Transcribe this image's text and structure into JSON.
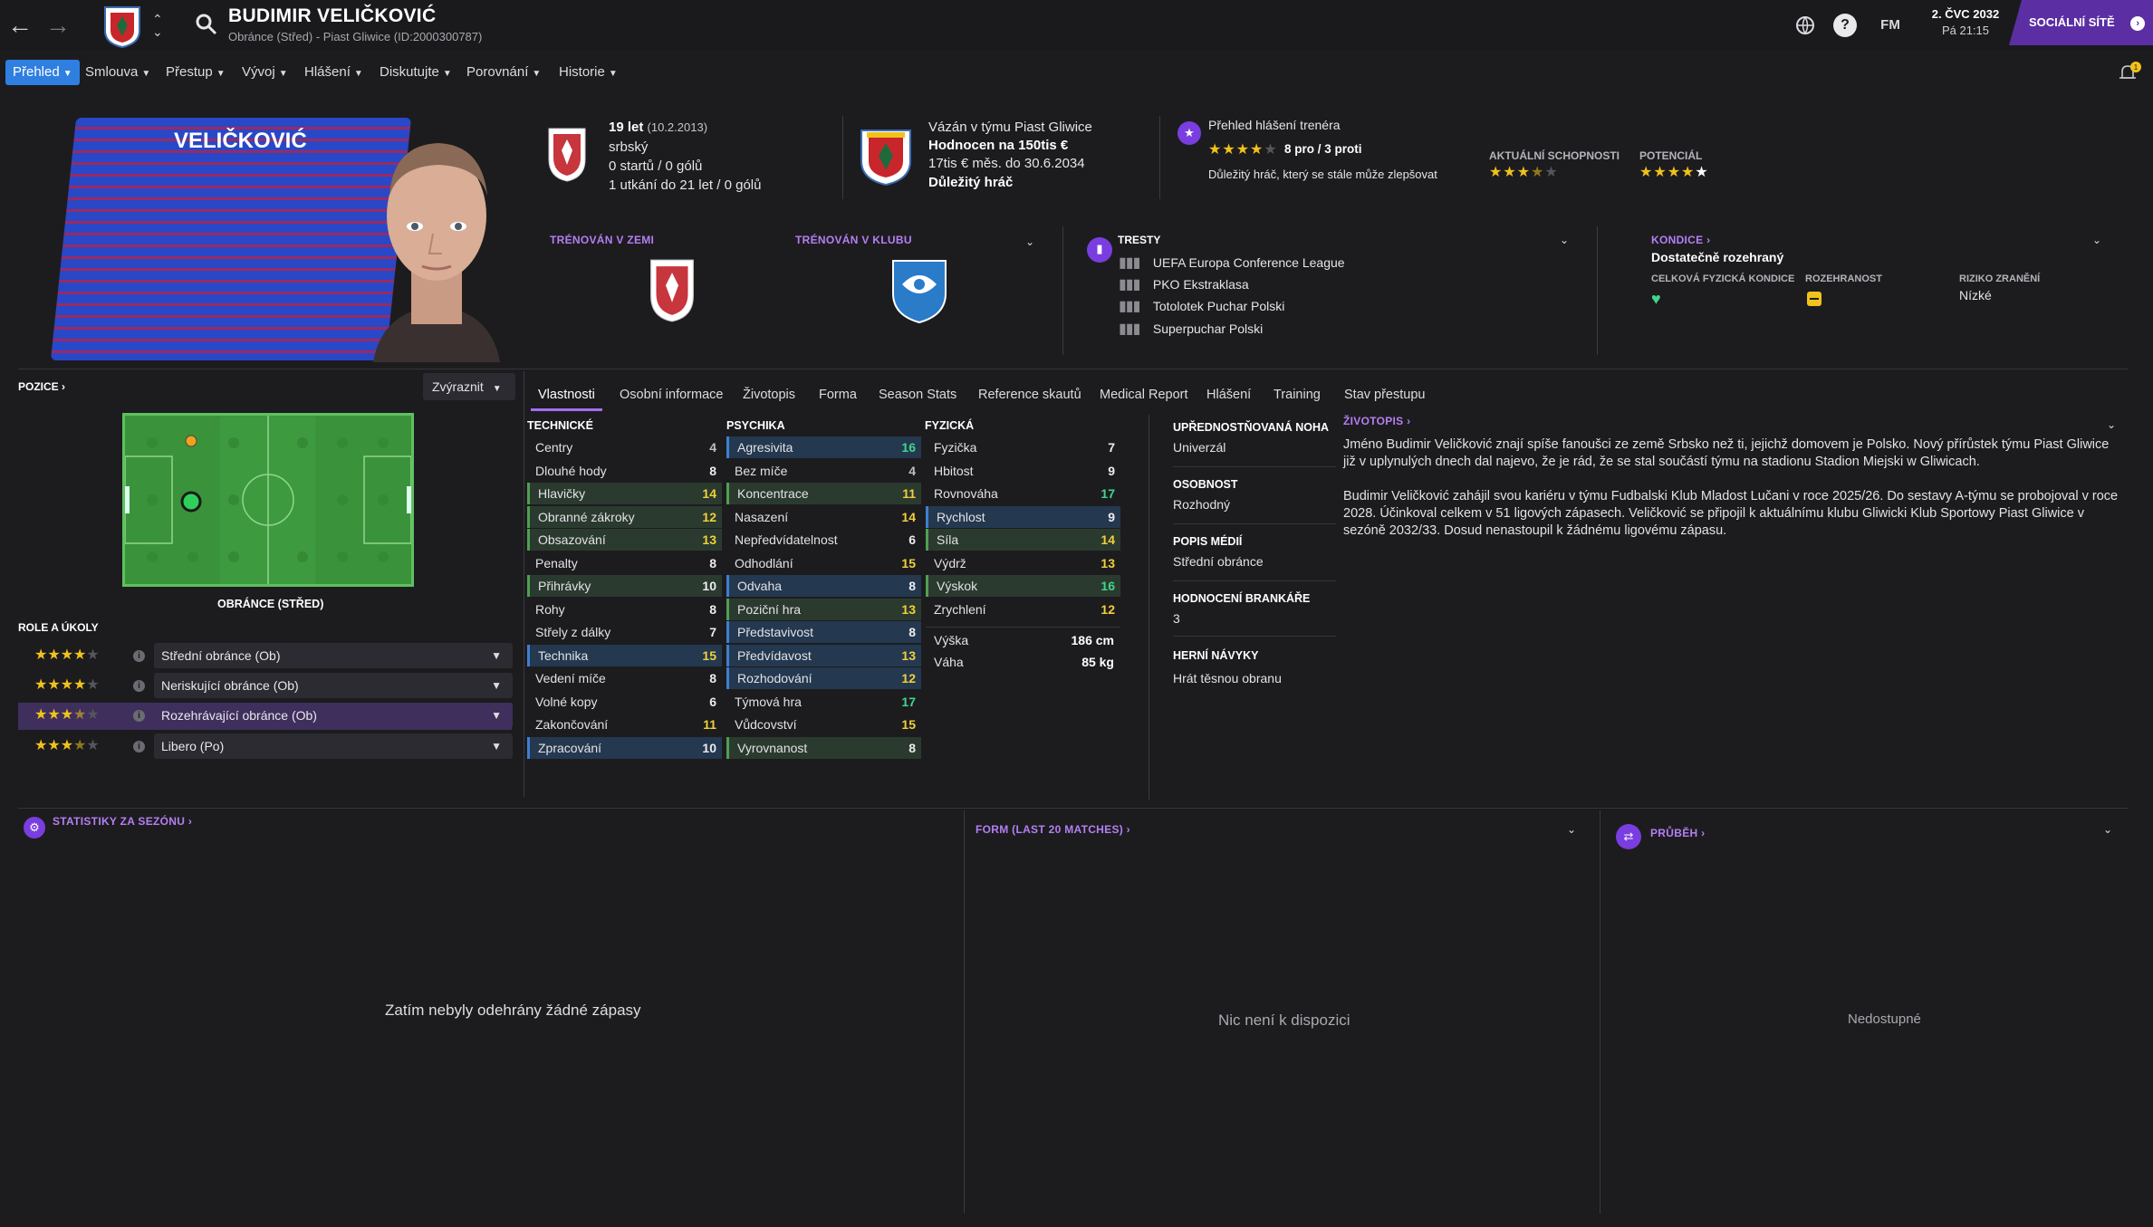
{
  "player": {
    "name": "BUDIMIR VELIČKOVIĆ",
    "subtitle": "Obránce (Střed) - Piast Gliwice (ID:2000300787)",
    "kit_name": "VELIČKOVIĆ"
  },
  "topbar": {
    "date": "2. ČVC 2032",
    "time": "Pá 21:15",
    "fm_label": "FM",
    "social_label": "SOCIÁLNÍ SÍTĚ",
    "help_label": "?",
    "notif_count": "1"
  },
  "menu": [
    {
      "label": "Přehled"
    },
    {
      "label": "Smlouva"
    },
    {
      "label": "Přestup"
    },
    {
      "label": "Vývoj"
    },
    {
      "label": "Hlášení"
    },
    {
      "label": "Diskutujte"
    },
    {
      "label": "Porovnání"
    },
    {
      "label": "Historie"
    }
  ],
  "bio_card": {
    "age": "19 let",
    "dob": "(10.2.2013)",
    "nationality": "srbský",
    "apps": "0 startů / 0 gólů",
    "u21": "1 utkání do 21 let / 0 gólů"
  },
  "contract": {
    "line1": "Vázán v týmu Piast Gliwice",
    "value": "Hodnocen na 150tis €",
    "wage": "17tis € měs. do 30.6.2034",
    "status": "Důležitý hráč"
  },
  "coach_report": {
    "title": "Přehled hlášení trenéra",
    "pros_cons": "8 pro / 3 proti",
    "note": "Důležitý hráč, který se stále může zlepšovat",
    "current_label": "AKTUÁLNÍ SCHOPNOSTI",
    "potential_label": "POTENCIÁL",
    "report_stars": 4,
    "current_stars": 3.5,
    "potential_stars": 5
  },
  "trained": {
    "nation_label": "TRÉNOVÁN V ZEMI",
    "club_label": "TRÉNOVÁN V KLUBU"
  },
  "bans": {
    "title": "TRESTY",
    "items": [
      "UEFA Europa Conference League",
      "PKO Ekstraklasa",
      "Totolotek Puchar Polski",
      "Superpuchar Polski"
    ]
  },
  "condition": {
    "title": "KONDICE",
    "status": "Dostatečně rozehraný",
    "fitness_label": "CELKOVÁ FYZICKÁ KONDICE",
    "sharpness_label": "ROZEHRANOST",
    "injury_label": "RIZIKO ZRANĚNÍ",
    "injury_value": "Nízké"
  },
  "position": {
    "title": "POZICE",
    "highlight_btn": "Zvýraznit",
    "caption": "OBRÁNCE (STŘED)",
    "roles_title": "ROLE A ÚKOLY",
    "roles": [
      {
        "label": "Střední obránce (Ob)",
        "stars": 4
      },
      {
        "label": "Neriskující obránce (Ob)",
        "stars": 4
      },
      {
        "label": "Rozehrávající obránce (Ob)",
        "stars": 3.5
      },
      {
        "label": "Libero (Po)",
        "stars": 3.5
      }
    ]
  },
  "tabs": [
    "Vlastnosti",
    "Osobní informace",
    "Životopis",
    "Forma",
    "Season Stats",
    "Reference skautů",
    "Medical Report",
    "Hlášení",
    "Training",
    "Stav přestupu"
  ],
  "attributes": {
    "technical_title": "TECHNICKÉ",
    "mental_title": "PSYCHIKA",
    "physical_title": "FYZICKÁ",
    "technical": [
      {
        "name": "Centry",
        "value": "4"
      },
      {
        "name": "Dlouhé hody",
        "value": "8"
      },
      {
        "name": "Hlavičky",
        "value": "14"
      },
      {
        "name": "Obranné zákroky",
        "value": "12"
      },
      {
        "name": "Obsazování",
        "value": "13"
      },
      {
        "name": "Penalty",
        "value": "8"
      },
      {
        "name": "Přihrávky",
        "value": "10"
      },
      {
        "name": "Rohy",
        "value": "8"
      },
      {
        "name": "Střely z dálky",
        "value": "7"
      },
      {
        "name": "Technika",
        "value": "15"
      },
      {
        "name": "Vedení míče",
        "value": "8"
      },
      {
        "name": "Volné kopy",
        "value": "6"
      },
      {
        "name": "Zakončování",
        "value": "11"
      },
      {
        "name": "Zpracování",
        "value": "10"
      }
    ],
    "mental": [
      {
        "name": "Agresivita",
        "value": "16"
      },
      {
        "name": "Bez míče",
        "value": "4"
      },
      {
        "name": "Koncentrace",
        "value": "11"
      },
      {
        "name": "Nasazení",
        "value": "14"
      },
      {
        "name": "Nepředvídatelnost",
        "value": "6"
      },
      {
        "name": "Odhodlání",
        "value": "15"
      },
      {
        "name": "Odvaha",
        "value": "8"
      },
      {
        "name": "Poziční hra",
        "value": "13"
      },
      {
        "name": "Představivost",
        "value": "8"
      },
      {
        "name": "Předvídavost",
        "value": "13"
      },
      {
        "name": "Rozhodování",
        "value": "12"
      },
      {
        "name": "Týmová hra",
        "value": "17"
      },
      {
        "name": "Vůdcovství",
        "value": "15"
      },
      {
        "name": "Vyrovnanost",
        "value": "8"
      }
    ],
    "physical": [
      {
        "name": "Fyzička",
        "value": "7"
      },
      {
        "name": "Hbitost",
        "value": "9"
      },
      {
        "name": "Rovnováha",
        "value": "17"
      },
      {
        "name": "Rychlost",
        "value": "9"
      },
      {
        "name": "Síla",
        "value": "14"
      },
      {
        "name": "Výdrž",
        "value": "13"
      },
      {
        "name": "Výskok",
        "value": "16"
      },
      {
        "name": "Zrychlení",
        "value": "12"
      }
    ],
    "height_label": "Výška",
    "height": "186 cm",
    "weight_label": "Váha",
    "weight": "85 kg"
  },
  "side": {
    "foot_label": "UPŘEDNOSTŇOVANÁ NOHA",
    "foot": "Univerzál",
    "personality_label": "OSOBNOST",
    "personality": "Rozhodný",
    "media_label": "POPIS MÉDIÍ",
    "media": "Střední obránce",
    "gk_label": "HODNOCENÍ BRANKÁŘE",
    "gk": "3",
    "ppm_label": "HERNÍ NÁVYKY",
    "ppm": "Hrát těsnou obranu"
  },
  "biography": {
    "title": "ŽIVOTOPIS",
    "p1": "Jméno Budimir Veličković znají spíše fanoušci ze země Srbsko než ti, jejichž domovem je Polsko. Nový přírůstek týmu Piast Gliwice již v uplynulých dnech dal najevo, že je rád, že se stal součástí týmu na stadionu Stadion Miejski w Gliwicach.",
    "p2": "Budimir Veličković zahájil svou kariéru v týmu Fudbalski Klub Mladost Lučani v roce 2025/26. Do sestavy A-týmu se probojoval v roce 2028. Účinkoval celkem v 51 ligových zápasech. Veličković se připojil k aktuálnímu klubu Gliwicki Klub Sportowy Piast Gliwice v sezóně 2032/33. Dosud nenastoupil k žádnému ligovému zápasu."
  },
  "bottom": {
    "stats_title": "STATISTIKY ZA SEZÓNU",
    "stats_empty": "Zatím nebyly odehrány žádné zápasy",
    "form_title": "FORM (LAST 20 MATCHES)",
    "form_empty": "Nic není k dispozici",
    "progress_title": "PRŮBĚH",
    "progress_empty": "Nedostupné"
  },
  "colors": {
    "accent": "#a36ef0",
    "menu_active": "#2f7fe0",
    "social": "#5b2fa3",
    "star": "#f1c21c"
  }
}
